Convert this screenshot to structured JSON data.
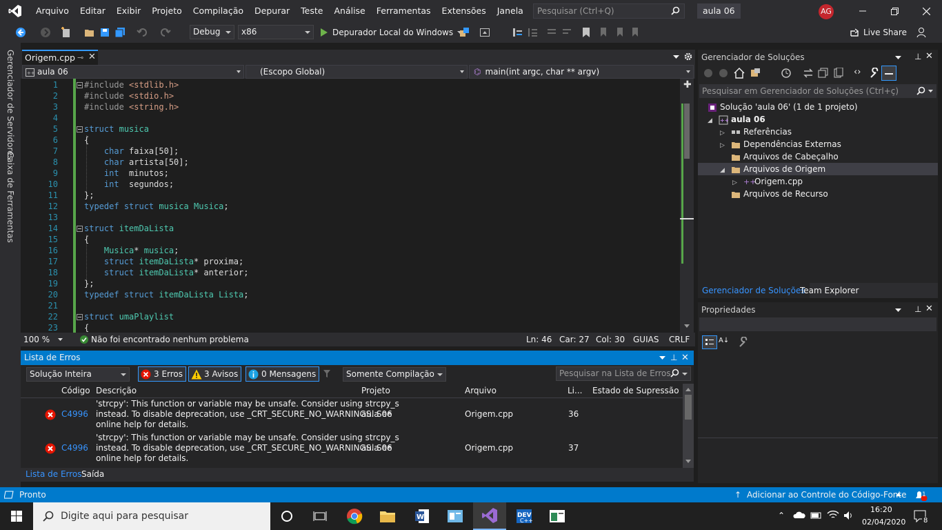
{
  "menubar": {
    "items": [
      "Arquivo",
      "Editar",
      "Exibir",
      "Projeto",
      "Compilação",
      "Depurar",
      "Teste",
      "Análise",
      "Ferramentas",
      "Extensões",
      "Janela",
      "Ajuda"
    ],
    "search_placeholder": "Pesquisar (Ctrl+Q)",
    "solution_name": "aula 06",
    "user_initials": "AG"
  },
  "toolbar": {
    "config": "Debug",
    "platform": "x86",
    "debugger": "Depurador Local do Windows",
    "live_share": "Live Share"
  },
  "left_rail": {
    "servers": "Gerenciador de Servidores",
    "toolbox": "Caixa de Ferramentas"
  },
  "editor": {
    "tab": "Origem.cpp",
    "nav_project": "aula 06",
    "nav_scope": "(Escopo Global)",
    "nav_member": "main(int argc, char ** argv)",
    "zoom": "100 %",
    "issues": "Não foi encontrado nenhum problema",
    "line": "Ln: 46",
    "col": "Car: 27",
    "column": "Col: 30",
    "tabs_mode": "GUIAS",
    "eol": "CRLF",
    "lines": [
      {
        "n": "1",
        "t": "#include <stdlib.h>"
      },
      {
        "n": "2",
        "t": "#include <stdio.h>"
      },
      {
        "n": "3",
        "t": "#include <string.h>"
      },
      {
        "n": "4",
        "t": ""
      },
      {
        "n": "5",
        "t": "struct musica"
      },
      {
        "n": "6",
        "t": "{"
      },
      {
        "n": "7",
        "t": "    char faixa[50];"
      },
      {
        "n": "8",
        "t": "    char artista[50];"
      },
      {
        "n": "9",
        "t": "    int  minutos;"
      },
      {
        "n": "10",
        "t": "    int  segundos;"
      },
      {
        "n": "11",
        "t": "};"
      },
      {
        "n": "12",
        "t": "typedef struct musica Musica;"
      },
      {
        "n": "13",
        "t": ""
      },
      {
        "n": "14",
        "t": "struct itemDaLista"
      },
      {
        "n": "15",
        "t": "{"
      },
      {
        "n": "16",
        "t": "    Musica* musica;"
      },
      {
        "n": "17",
        "t": "    struct itemDaLista* proxima;"
      },
      {
        "n": "18",
        "t": "    struct itemDaLista* anterior;"
      },
      {
        "n": "19",
        "t": "};"
      },
      {
        "n": "20",
        "t": "typedef struct itemDaLista Lista;"
      },
      {
        "n": "21",
        "t": ""
      },
      {
        "n": "22",
        "t": "struct umaPlaylist"
      },
      {
        "n": "23",
        "t": "{"
      }
    ]
  },
  "error_list": {
    "title": "Lista de Erros",
    "scope": "Solução Inteira",
    "errors": "3 Erros",
    "warnings": "3 Avisos",
    "messages": "0 Mensagens",
    "build_filter": "Somente Compilação",
    "search_placeholder": "Pesquisar na Lista de Erros",
    "columns": [
      "Código",
      "Descrição",
      "Projeto",
      "Arquivo",
      "Li...",
      "Estado de Supressão"
    ],
    "rows": [
      {
        "code": "C4996",
        "desc1": "'strcpy': This function or variable may be unsafe. Consider using strcpy_s",
        "desc2": "instead. To disable deprecation, use _CRT_SECURE_NO_WARNINGS. See",
        "desc3": "online help for details.",
        "project": "aula 06",
        "file": "Origem.cpp",
        "line": "36"
      },
      {
        "code": "C4996",
        "desc1": "'strcpy': This function or variable may be unsafe. Consider using strcpy_s",
        "desc2": "instead. To disable deprecation, use _CRT_SECURE_NO_WARNINGS. See",
        "desc3": "online help for details.",
        "project": "aula 06",
        "file": "Origem.cpp",
        "line": "37"
      }
    ],
    "tabs": [
      "Lista de Erros",
      "Saída"
    ]
  },
  "solution_explorer": {
    "title": "Gerenciador de Soluções",
    "search_placeholder": "Pesquisar em Gerenciador de Soluções (Ctrl+ç)",
    "items": [
      {
        "label": "Solução 'aula 06' (1 de 1 projeto)"
      },
      {
        "label": "aula 06"
      },
      {
        "label": "Referências"
      },
      {
        "label": "Dependências Externas"
      },
      {
        "label": "Arquivos de Cabeçalho"
      },
      {
        "label": "Arquivos de Origem"
      },
      {
        "label": "Origem.cpp"
      },
      {
        "label": "Arquivos de Recurso"
      }
    ],
    "tabs": [
      "Gerenciador de Soluções",
      "Team Explorer"
    ]
  },
  "properties": {
    "title": "Propriedades"
  },
  "statusbar": {
    "ready": "Pronto",
    "source_control": "Adicionar ao Controle do Código-Fonte",
    "notifications": "1"
  },
  "taskbar": {
    "search_placeholder": "Digite aqui para pesquisar",
    "time": "16:20",
    "date": "02/04/2020",
    "notif_count": "8"
  },
  "colors": {
    "accent": "#007acc",
    "error": "#e51400",
    "warning": "#ffcc00",
    "info": "#1ba1e2",
    "vs_purple": "#68217a"
  }
}
